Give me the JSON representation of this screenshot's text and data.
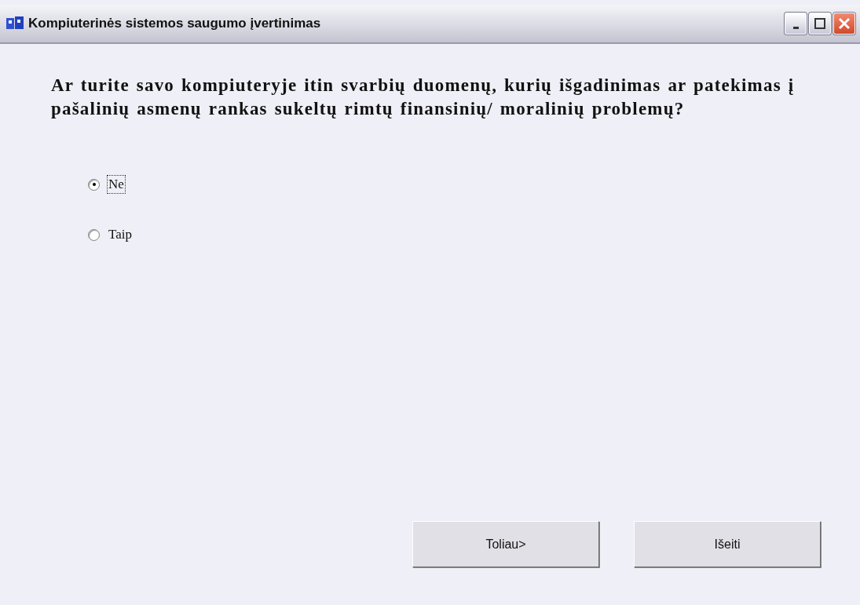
{
  "window": {
    "title": "Kompiuterinės sistemos saugumo įvertinimas"
  },
  "question": "Ar turite savo kompiuteryje itin svarbių duomenų, kurių išgadinimas ar patekimas į pašalinių asmenų rankas sukeltų rimtų finansinių/ moralinių problemų?",
  "options": [
    {
      "label": "Ne",
      "selected": true,
      "focused": true
    },
    {
      "label": "Taip",
      "selected": false,
      "focused": false
    }
  ],
  "buttons": [
    "Toliau>",
    "Išeiti"
  ]
}
